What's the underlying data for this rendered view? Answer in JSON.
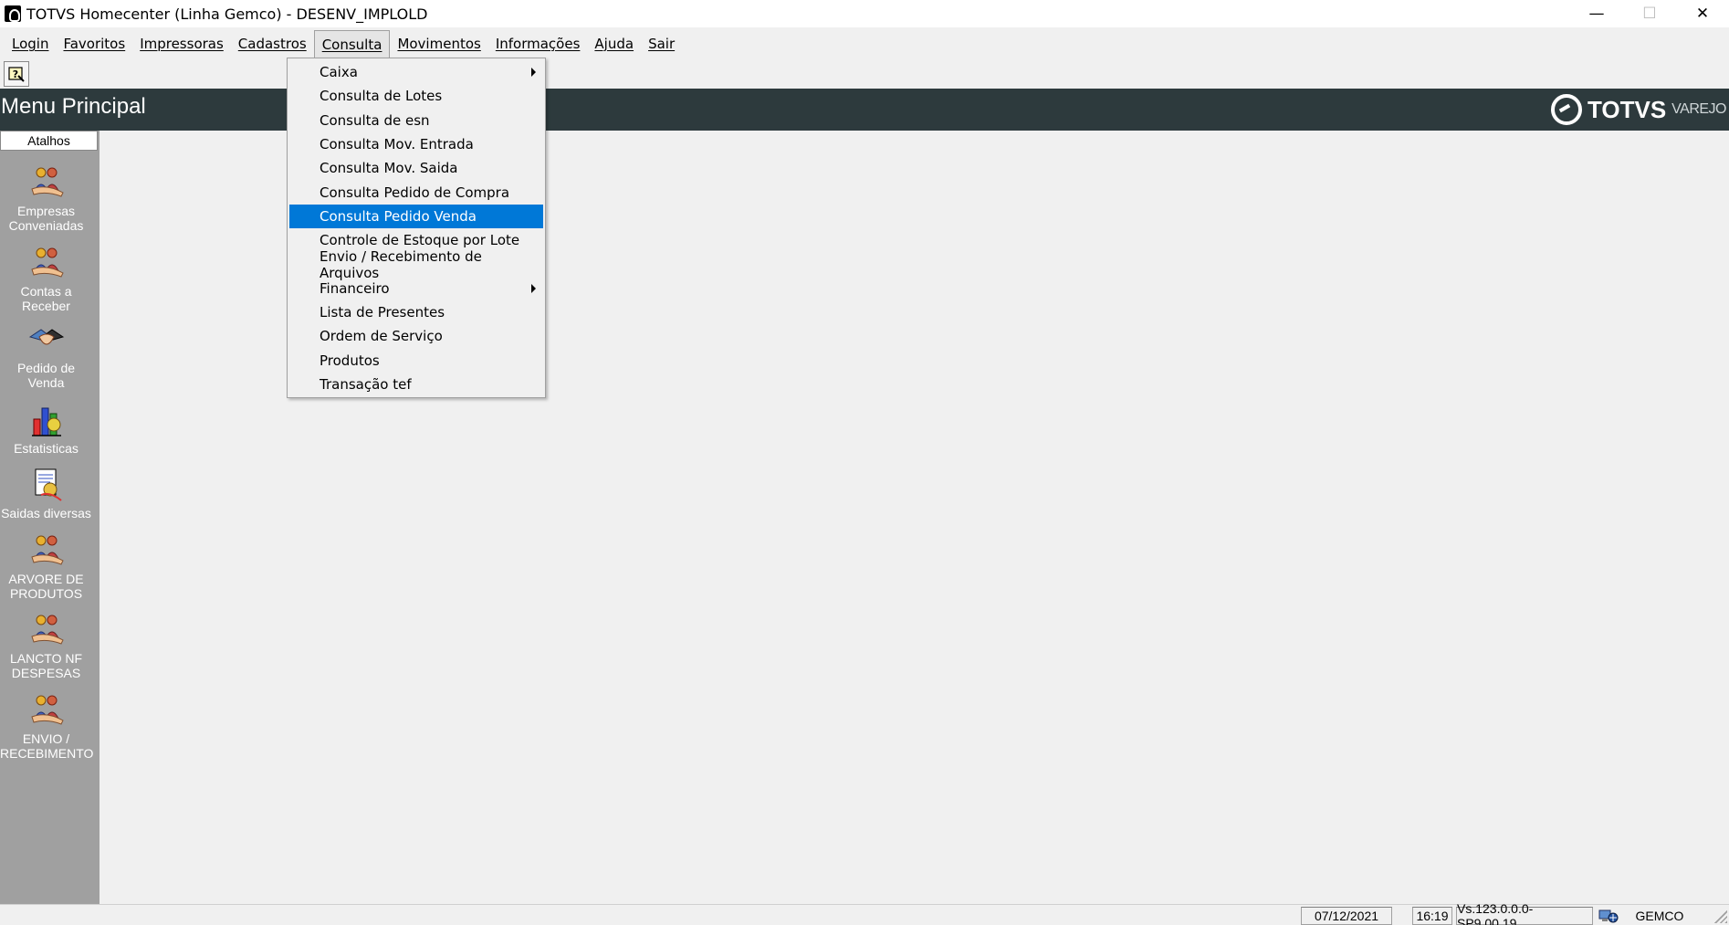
{
  "window": {
    "title": "TOTVS Homecenter (Linha Gemco) - DESENV_IMPLOLD",
    "minimize": "—",
    "maximize": "☐",
    "close": "✕"
  },
  "menubar": {
    "items": [
      {
        "label": "Login"
      },
      {
        "label": "Favoritos"
      },
      {
        "label": "Impressoras"
      },
      {
        "label": "Cadastros"
      },
      {
        "label": "Consulta"
      },
      {
        "label": "Movimentos"
      },
      {
        "label": "Informações"
      },
      {
        "label": "Ajuda"
      },
      {
        "label": "Sair"
      }
    ],
    "open_menu": "Consulta"
  },
  "header": {
    "title": "Menu Principal",
    "brand_name": "TOTVS",
    "brand_sub": "VAREJO"
  },
  "sidebar": {
    "tab_label": "Atalhos",
    "shortcuts": [
      {
        "label_line1": "Empresas",
        "label_line2": "Conveniadas",
        "icon": "people-icon"
      },
      {
        "label_line1": "Contas a",
        "label_line2": "Receber",
        "icon": "people-icon"
      },
      {
        "label_line1": "Pedido de",
        "label_line2": "Venda",
        "icon": "handshake-icon"
      },
      {
        "label_line1": "Estatisticas",
        "label_line2": "",
        "icon": "chart-icon"
      },
      {
        "label_line1": "Saidas diversas",
        "label_line2": "",
        "icon": "document-icon"
      },
      {
        "label_line1": "ARVORE DE",
        "label_line2": "PRODUTOS",
        "icon": "people-icon"
      },
      {
        "label_line1": "LANCTO NF",
        "label_line2": "DESPESAS",
        "icon": "people-icon"
      },
      {
        "label_line1": "ENVIO /",
        "label_line2": "RECEBIMENTO",
        "icon": "people-icon"
      }
    ]
  },
  "dropdown": {
    "items": [
      {
        "label": "Caixa",
        "has_submenu": true
      },
      {
        "label": "Consulta de Lotes",
        "has_submenu": false
      },
      {
        "label": "Consulta de esn",
        "has_submenu": false
      },
      {
        "label": "Consulta Mov. Entrada",
        "has_submenu": false
      },
      {
        "label": "Consulta Mov. Saida",
        "has_submenu": false
      },
      {
        "label": "Consulta Pedido de Compra",
        "has_submenu": false
      },
      {
        "label": "Consulta Pedido Venda",
        "has_submenu": false,
        "selected": true
      },
      {
        "label": "Controle de Estoque por Lote",
        "has_submenu": false
      },
      {
        "label": "Envio / Recebimento de Arquivos",
        "has_submenu": false
      },
      {
        "label": "Financeiro",
        "has_submenu": true
      },
      {
        "label": "Lista de Presentes",
        "has_submenu": false
      },
      {
        "label": "Ordem de Serviço",
        "has_submenu": false
      },
      {
        "label": "Produtos",
        "has_submenu": false
      },
      {
        "label": "Transação tef",
        "has_submenu": false
      }
    ]
  },
  "statusbar": {
    "date": "07/12/2021",
    "time": "16:19",
    "version": "Vs.123.0.0.0-SP9.00.19",
    "user": "GEMCO"
  },
  "colors": {
    "header_bg": "#2d3a3d",
    "sidebar_bg": "#a0a0a0",
    "selection": "#0078d7"
  }
}
